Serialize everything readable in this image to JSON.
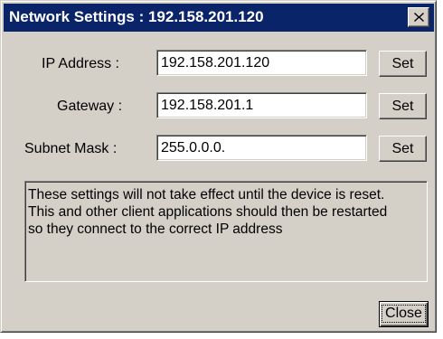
{
  "window": {
    "title": "Network Settings : 192.158.201.120",
    "close_glyph": "close-icon"
  },
  "fields": [
    {
      "label": "IP Address :",
      "value": "192.158.201.120",
      "button": "Set"
    },
    {
      "label": "Gateway :",
      "value": "192.158.201.1",
      "button": "Set"
    },
    {
      "label": "Subnet Mask :",
      "value": "255.0.0.0.",
      "button": "Set"
    }
  ],
  "message": {
    "lines": [
      "These settings will not take effect until the device is reset.",
      "This and other client applications should then be restarted",
      "so they connect to the correct IP address"
    ]
  },
  "footer": {
    "close_label": "Close"
  },
  "colors": {
    "titlebar": "#0a246a",
    "face": "#d4d0c8"
  }
}
